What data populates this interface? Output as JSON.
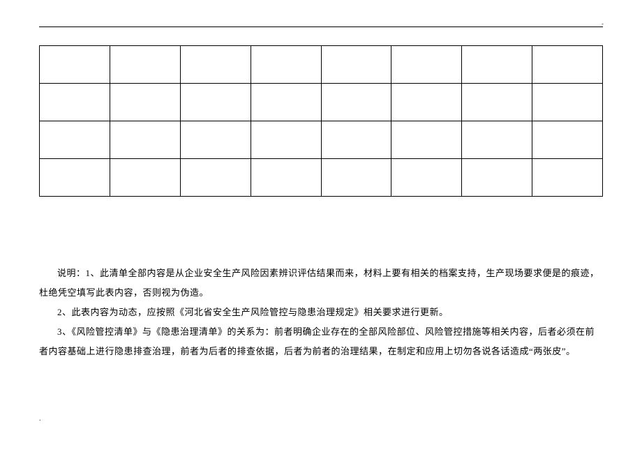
{
  "decor": {
    "corner": "..",
    "footer": "."
  },
  "table": {
    "rows": 4,
    "cols": 8
  },
  "notes": {
    "p1": "说明：1、此清单全部内容是从企业安全生产风险因素辨识评估结果而来，材料上要有相关的档案支持，生产现场要求便是的痕迹，杜绝凭空填写此表内容，否则视为伪造。",
    "p2": "2、此表内容为动态，应按照《河北省安全生产风险管控与隐患治理规定》相关要求进行更新。",
    "p3": "3、《风险管控清单》与《隐患治理清单》的关系为：前者明确企业存在的全部风险部位、风险管控措施等相关内容，后者必须在前者内容基础上进行隐患排查治理，前者为后者的排查依据，后者为前者的治理结果，在制定和应用上切勿各说各话造成“两张皮”。"
  }
}
